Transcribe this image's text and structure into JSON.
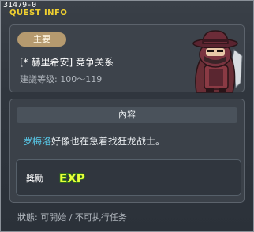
{
  "window": {
    "id_label": "31479-0",
    "title": "QUEST INFO"
  },
  "quest": {
    "badge": "主要",
    "name": "[* 赫里希安] 竞争关系",
    "level": "建議等级: 100～119"
  },
  "content": {
    "header": "內容",
    "npc_name": "罗梅洛",
    "text": "好像也在急着找狂龙战士。"
  },
  "reward": {
    "label": "獎勵",
    "exp_text": "EXP"
  },
  "status": {
    "text": "狀態: 可開始 / 不可执行任务"
  },
  "colors": {
    "title": "#f0d030",
    "npc_name": "#58c8e8",
    "badge": "#b59a6f",
    "exp_text": "#e8ff3a"
  }
}
